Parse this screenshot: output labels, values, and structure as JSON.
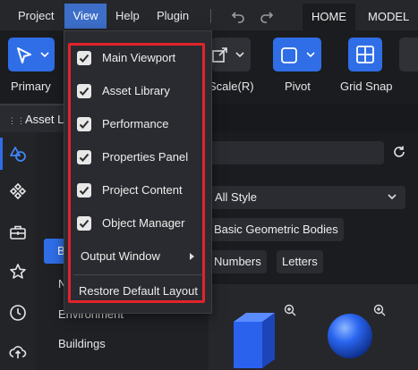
{
  "menubar": {
    "items": [
      "Project",
      "View",
      "Help",
      "Plugin"
    ],
    "tabs": [
      "HOME",
      "MODEL"
    ]
  },
  "ribbon": {
    "primary_label": "Primary",
    "scale_label": "Scale(R)",
    "pivot_label": "Pivot",
    "gridsnap_label": "Grid Snap"
  },
  "panel": {
    "tab_label": "Asset L"
  },
  "tree": {
    "selected_initial": "B",
    "item_n": "N",
    "environment": "Environment",
    "buildings": "Buildings"
  },
  "content": {
    "style_select": "All Style",
    "chips": [
      "Basic Geometric Bodies",
      "Numbers",
      "Letters"
    ]
  },
  "view_menu": {
    "items": [
      {
        "label": "Main Viewport",
        "checked": true
      },
      {
        "label": "Asset Library",
        "checked": true
      },
      {
        "label": "Performance",
        "checked": true
      },
      {
        "label": "Properties Panel",
        "checked": true
      },
      {
        "label": "Project Content",
        "checked": true
      },
      {
        "label": "Object Manager",
        "checked": true
      }
    ],
    "output_window": "Output Window",
    "restore_default": "Restore Default Layout"
  },
  "colors": {
    "accent": "#2f6ee6",
    "highlight_border": "#e0232b",
    "active_menu": "#3d6fc9"
  }
}
